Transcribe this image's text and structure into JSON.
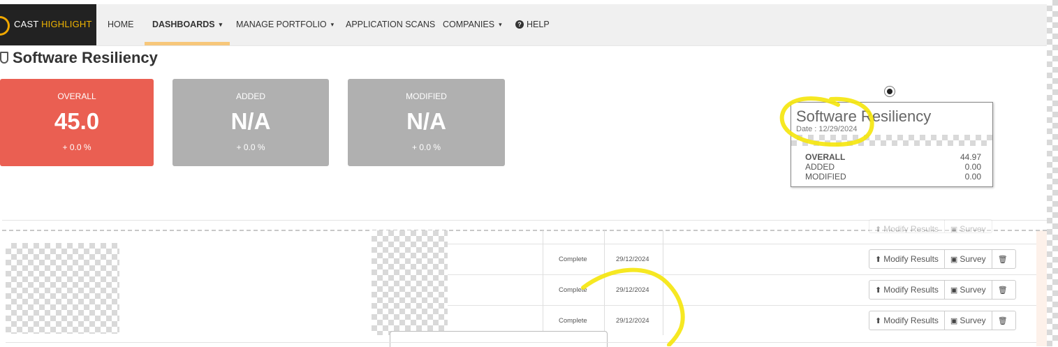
{
  "navbar": {
    "logo": {
      "word1": "CAST",
      "word2": "HIGHLIGHT"
    },
    "items": [
      {
        "label": "HOME"
      },
      {
        "label": "DASHBOARDS",
        "caret": "▾"
      },
      {
        "label": "MANAGE PORTFOLIO",
        "caret": "▾"
      },
      {
        "label": "APPLICATION SCANS"
      },
      {
        "label": "COMPANIES",
        "caret": "▾"
      },
      {
        "label": "HELP",
        "icon": "question-circle-icon"
      }
    ],
    "active": "DASHBOARDS"
  },
  "page": {
    "title": "Software Resiliency",
    "icon": "shield-icon"
  },
  "kpis": [
    {
      "label": "OVERALL",
      "value": "45.0",
      "change": "+ 0.0 %",
      "color": "#ea5f52"
    },
    {
      "label": "ADDED",
      "value": "N/A",
      "change": "+ 0.0 %",
      "color": "#b0b0b0"
    },
    {
      "label": "MODIFIED",
      "value": "N/A",
      "change": "+ 0.0 %",
      "color": "#b0b0b0"
    }
  ],
  "tooltip": {
    "title": "Software Resiliency",
    "date": "Date : 12/29/2024",
    "rows": [
      {
        "key": "OVERALL",
        "value": "44.97"
      },
      {
        "key": "ADDED",
        "value": "0.00"
      },
      {
        "key": "MODIFIED",
        "value": "0.00"
      }
    ]
  },
  "scans": {
    "rows": [
      {
        "status": "Complete",
        "date": "29/12/2024"
      },
      {
        "status": "Complete",
        "date": "29/12/2024"
      },
      {
        "status": "Complete",
        "date": "29/12/2024"
      }
    ],
    "actions": {
      "modify": "Modify Results",
      "survey": "Survey"
    }
  },
  "colors": {
    "accent": "#f7c77a",
    "highlight_scribble": "#f5e60a"
  }
}
